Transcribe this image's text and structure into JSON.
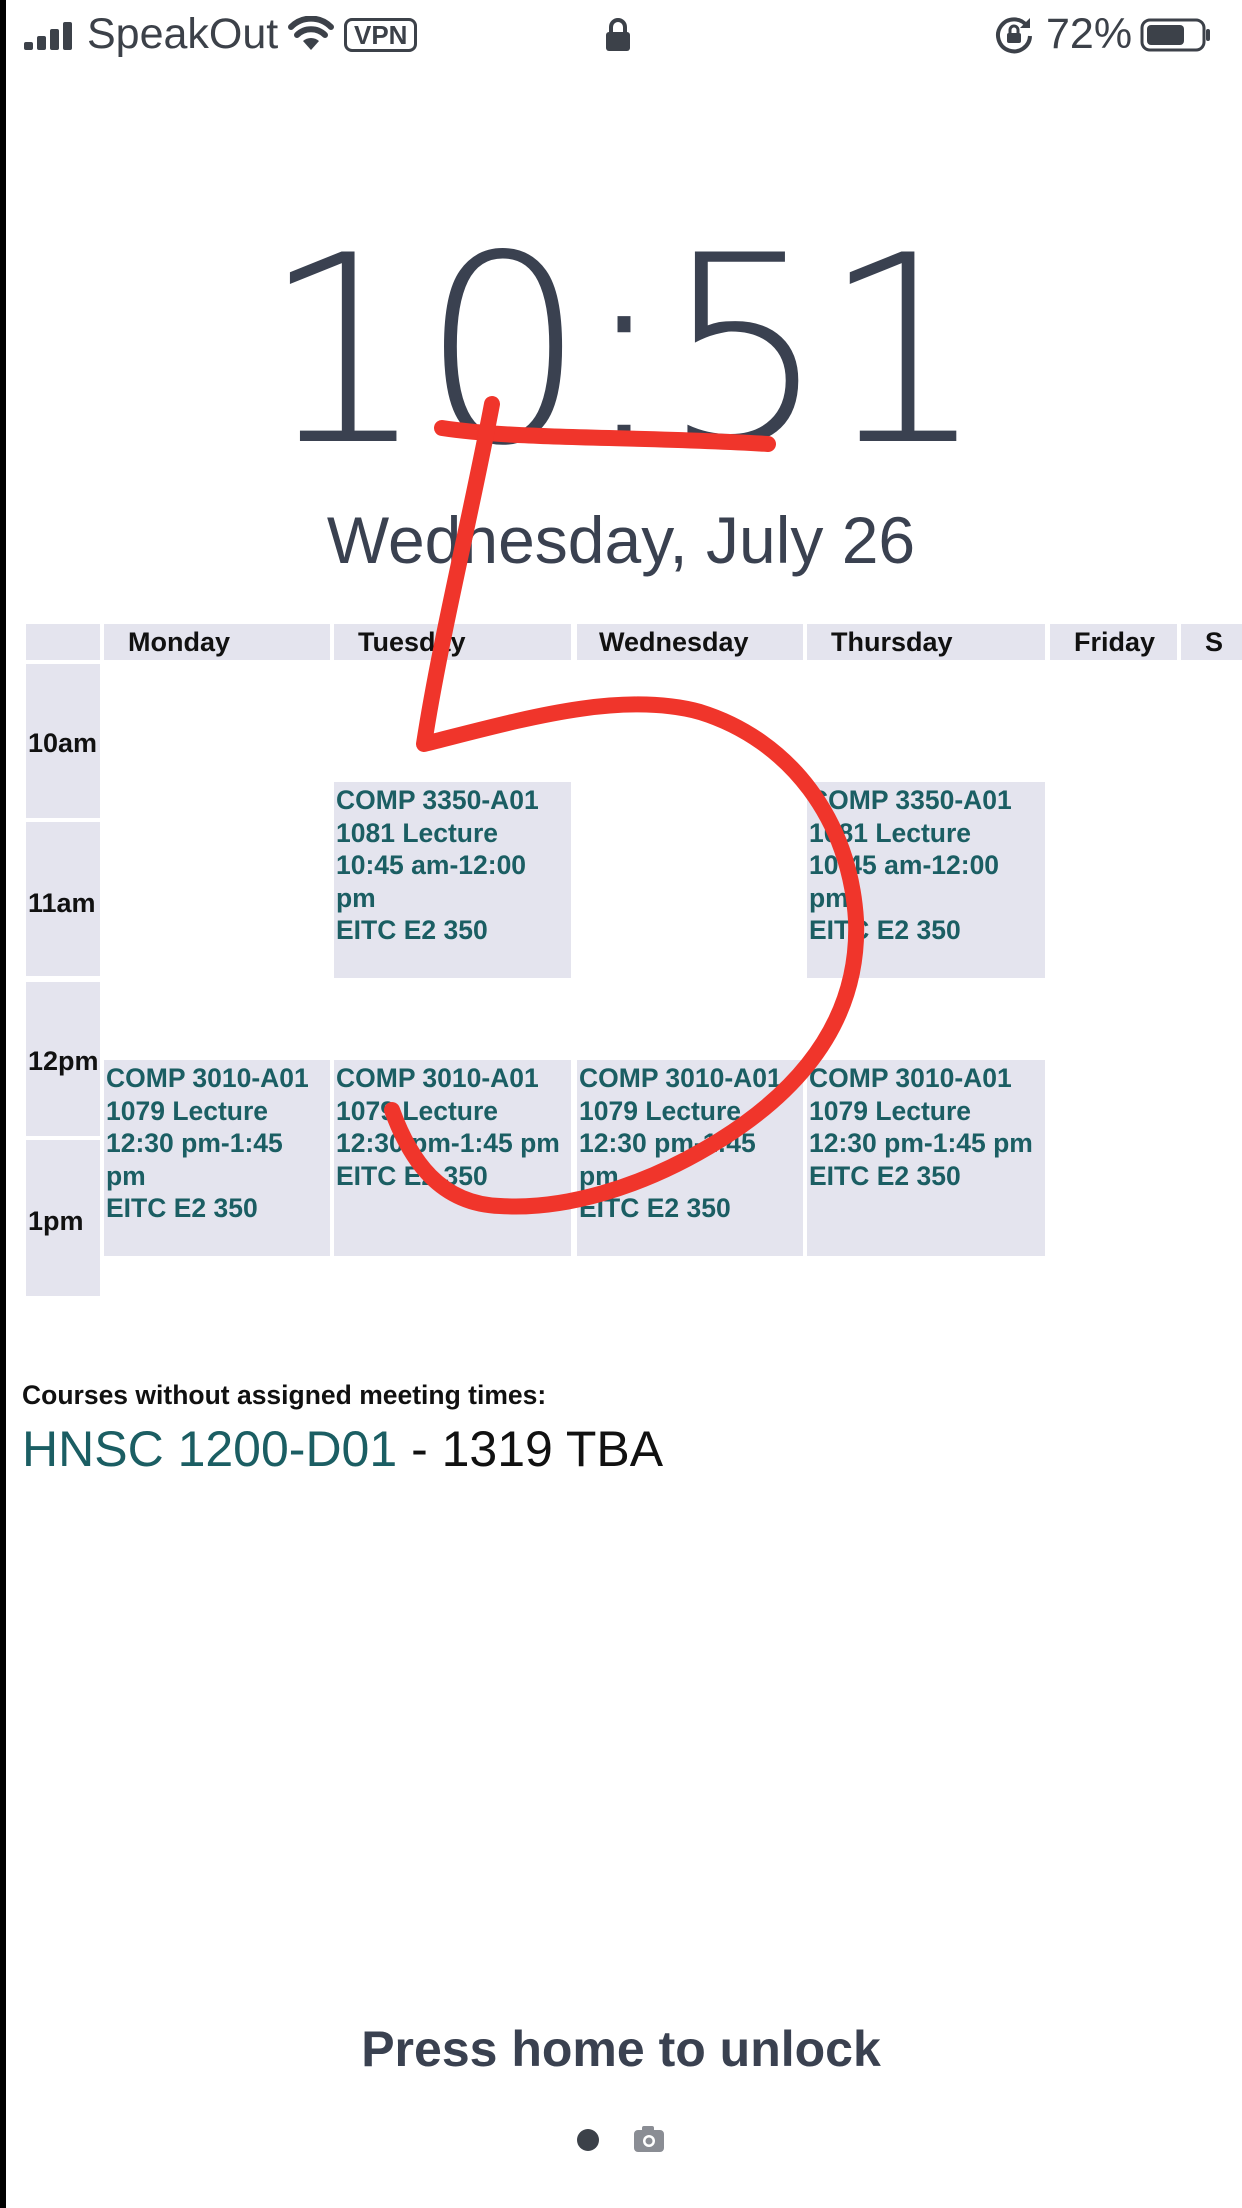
{
  "status_bar": {
    "carrier": "SpeakOut",
    "vpn_label": "VPN",
    "battery_percent": "72%",
    "battery_level": 0.72
  },
  "lock_screen": {
    "time": "10:51",
    "date": "Wednesday, July 26",
    "unlock_hint": "Press home to unlock"
  },
  "schedule": {
    "days": [
      "Monday",
      "Tuesday",
      "Wednesday",
      "Thursday",
      "Friday",
      "S"
    ],
    "times": [
      "10am",
      "11am",
      "12pm",
      "1pm"
    ],
    "events": [
      {
        "day": "Tuesday",
        "lines": [
          "COMP 3350-A01",
          "1081 Lecture",
          "10:45 am-12:00",
          "pm",
          "EITC E2 350"
        ]
      },
      {
        "day": "Thursday",
        "lines": [
          "COMP 3350-A01",
          "1081 Lecture",
          "10:45 am-12:00",
          "pm",
          "EITC E2 350"
        ]
      },
      {
        "day": "Monday",
        "lines": [
          "COMP 3010-A01",
          "1079 Lecture",
          "12:30 pm-1:45",
          "pm",
          "EITC E2 350"
        ]
      },
      {
        "day": "Tuesday",
        "lines": [
          "COMP 3010-A01",
          "1079 Lecture",
          "12:30 pm-1:45 pm",
          "EITC E2 350"
        ]
      },
      {
        "day": "Wednesday",
        "lines": [
          "COMP 3010-A01",
          "1079 Lecture",
          "12:30 pm-1:45",
          "pm",
          "EITC E2 350"
        ]
      },
      {
        "day": "Thursday",
        "lines": [
          "COMP 3010-A01",
          "1079 Lecture",
          "12:30 pm-1:45 pm",
          "EITC E2 350"
        ]
      }
    ],
    "no_meeting_title": "Courses without assigned meeting times:",
    "no_meeting_course": {
      "code": "HNSC 1200-D01",
      "rest": " - 1319 TBA"
    }
  },
  "icons": [
    "signal-icon",
    "wifi-icon",
    "padlock-icon",
    "rotation-lock-icon",
    "battery-icon",
    "page-dot-icon",
    "camera-icon"
  ],
  "colors": {
    "text": "#3a4150",
    "course": "#1b5e63",
    "cell": "#e4e4ee",
    "scribble": "#f0352b"
  }
}
